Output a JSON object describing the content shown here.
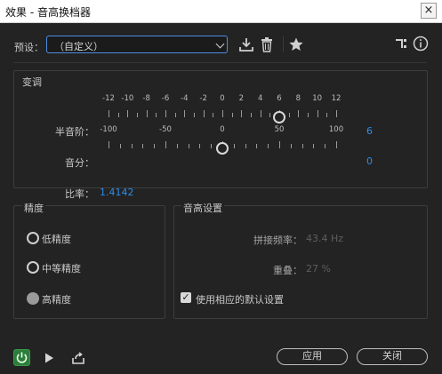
{
  "window": {
    "title": "效果 - 音高换档器",
    "close_label": "×"
  },
  "preset": {
    "label": "预设：",
    "value": "（自定义）"
  },
  "toolbar_icons": [
    "download-icon",
    "trash-icon",
    "star-icon",
    "routing-icon",
    "info-icon"
  ],
  "pitch_group": {
    "title": "变调",
    "semitone": {
      "label": "半音阶：",
      "ticks": [
        "-12",
        "-10",
        "-8",
        "-6",
        "-4",
        "-2",
        "0",
        "2",
        "4",
        "6",
        "8",
        "10",
        "12"
      ],
      "value": "6",
      "value_number": 6,
      "min": -12,
      "max": 12
    },
    "cents": {
      "label": "音分：",
      "ticks": [
        "-100",
        "-50",
        "0",
        "50",
        "100"
      ],
      "value": "0",
      "value_number": 0,
      "min": -100,
      "max": 100
    },
    "ratio": {
      "label": "比率：",
      "value": "1.4142"
    }
  },
  "precision_group": {
    "title": "精度",
    "options": [
      {
        "label": "低精度",
        "selected": false
      },
      {
        "label": "中等精度",
        "selected": false
      },
      {
        "label": "高精度",
        "selected": true
      }
    ]
  },
  "pitch_settings_group": {
    "title": "音高设置",
    "splice_frequency": {
      "label": "拼接频率：",
      "value": "43.4 Hz"
    },
    "overlap": {
      "label": "重叠：",
      "value": "27 %"
    },
    "default_settings": {
      "label": "使用相应的默认设置",
      "checked": true
    }
  },
  "buttons": {
    "apply": "应用",
    "close": "关闭"
  },
  "colors": {
    "accent": "#2f8be6",
    "power": "#2d7d3a",
    "background": "#232323"
  }
}
